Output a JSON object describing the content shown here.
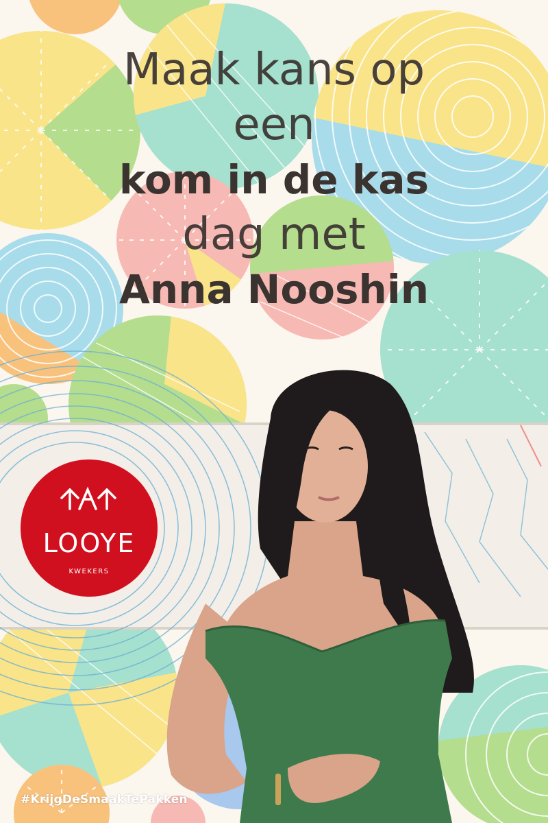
{
  "headline": {
    "line1": "Maak kans op",
    "line2": "een",
    "line3": "kom in de kas",
    "line4": "dag met",
    "line5": "Anna Nooshin"
  },
  "logo": {
    "brand": "LOOYE",
    "subtitle": "KWEKERS"
  },
  "hashtag": "#KrijgDeSmaakTePakken",
  "colors": {
    "background": "#fbf6ee",
    "yellow": "#f9e48a",
    "mint": "#a6e0cf",
    "green": "#b5dd8e",
    "pink": "#f7b9b3",
    "blue": "#a8dcea",
    "orange": "#f8c27d",
    "logo_red": "#d0101f",
    "dress_green": "#3f7a4c",
    "text_dark": "#3a3330"
  }
}
